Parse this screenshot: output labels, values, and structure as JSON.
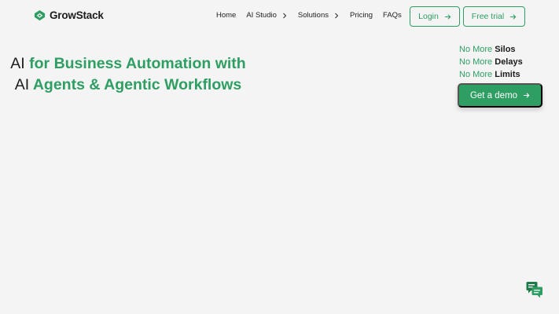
{
  "brand": {
    "name": "GrowStack",
    "icon": "growstack-logo-icon"
  },
  "nav": {
    "items": [
      {
        "label": "Home",
        "has_chevron": false
      },
      {
        "label": "AI Studio",
        "has_chevron": true
      },
      {
        "label": "Solutions",
        "has_chevron": true
      },
      {
        "label": "Pricing",
        "has_chevron": false
      },
      {
        "label": "FAQs",
        "has_chevron": false
      }
    ]
  },
  "header_buttons": {
    "login_label": "Login",
    "trial_label": "Free trial",
    "icon": "arrow-right-icon"
  },
  "hero": {
    "line1_prefix": "AI",
    "line1_rest": " for Business Automation with",
    "line2_prefix": "AI",
    "line2_rest": " Agents & Agentic Workflows"
  },
  "taglines": [
    {
      "prefix": "No More",
      "word": "Silos"
    },
    {
      "prefix": "No More",
      "word": "Delays"
    },
    {
      "prefix": "No More",
      "word": "Limits"
    }
  ],
  "cta": {
    "demo_label": "Get a demo",
    "icon": "arrow-right-icon"
  },
  "chat": {
    "icon": "chat-bubbles-icon"
  },
  "colors": {
    "accent": "#2e9e63",
    "background": "#f4f4f4",
    "text": "#1c1c1c"
  }
}
